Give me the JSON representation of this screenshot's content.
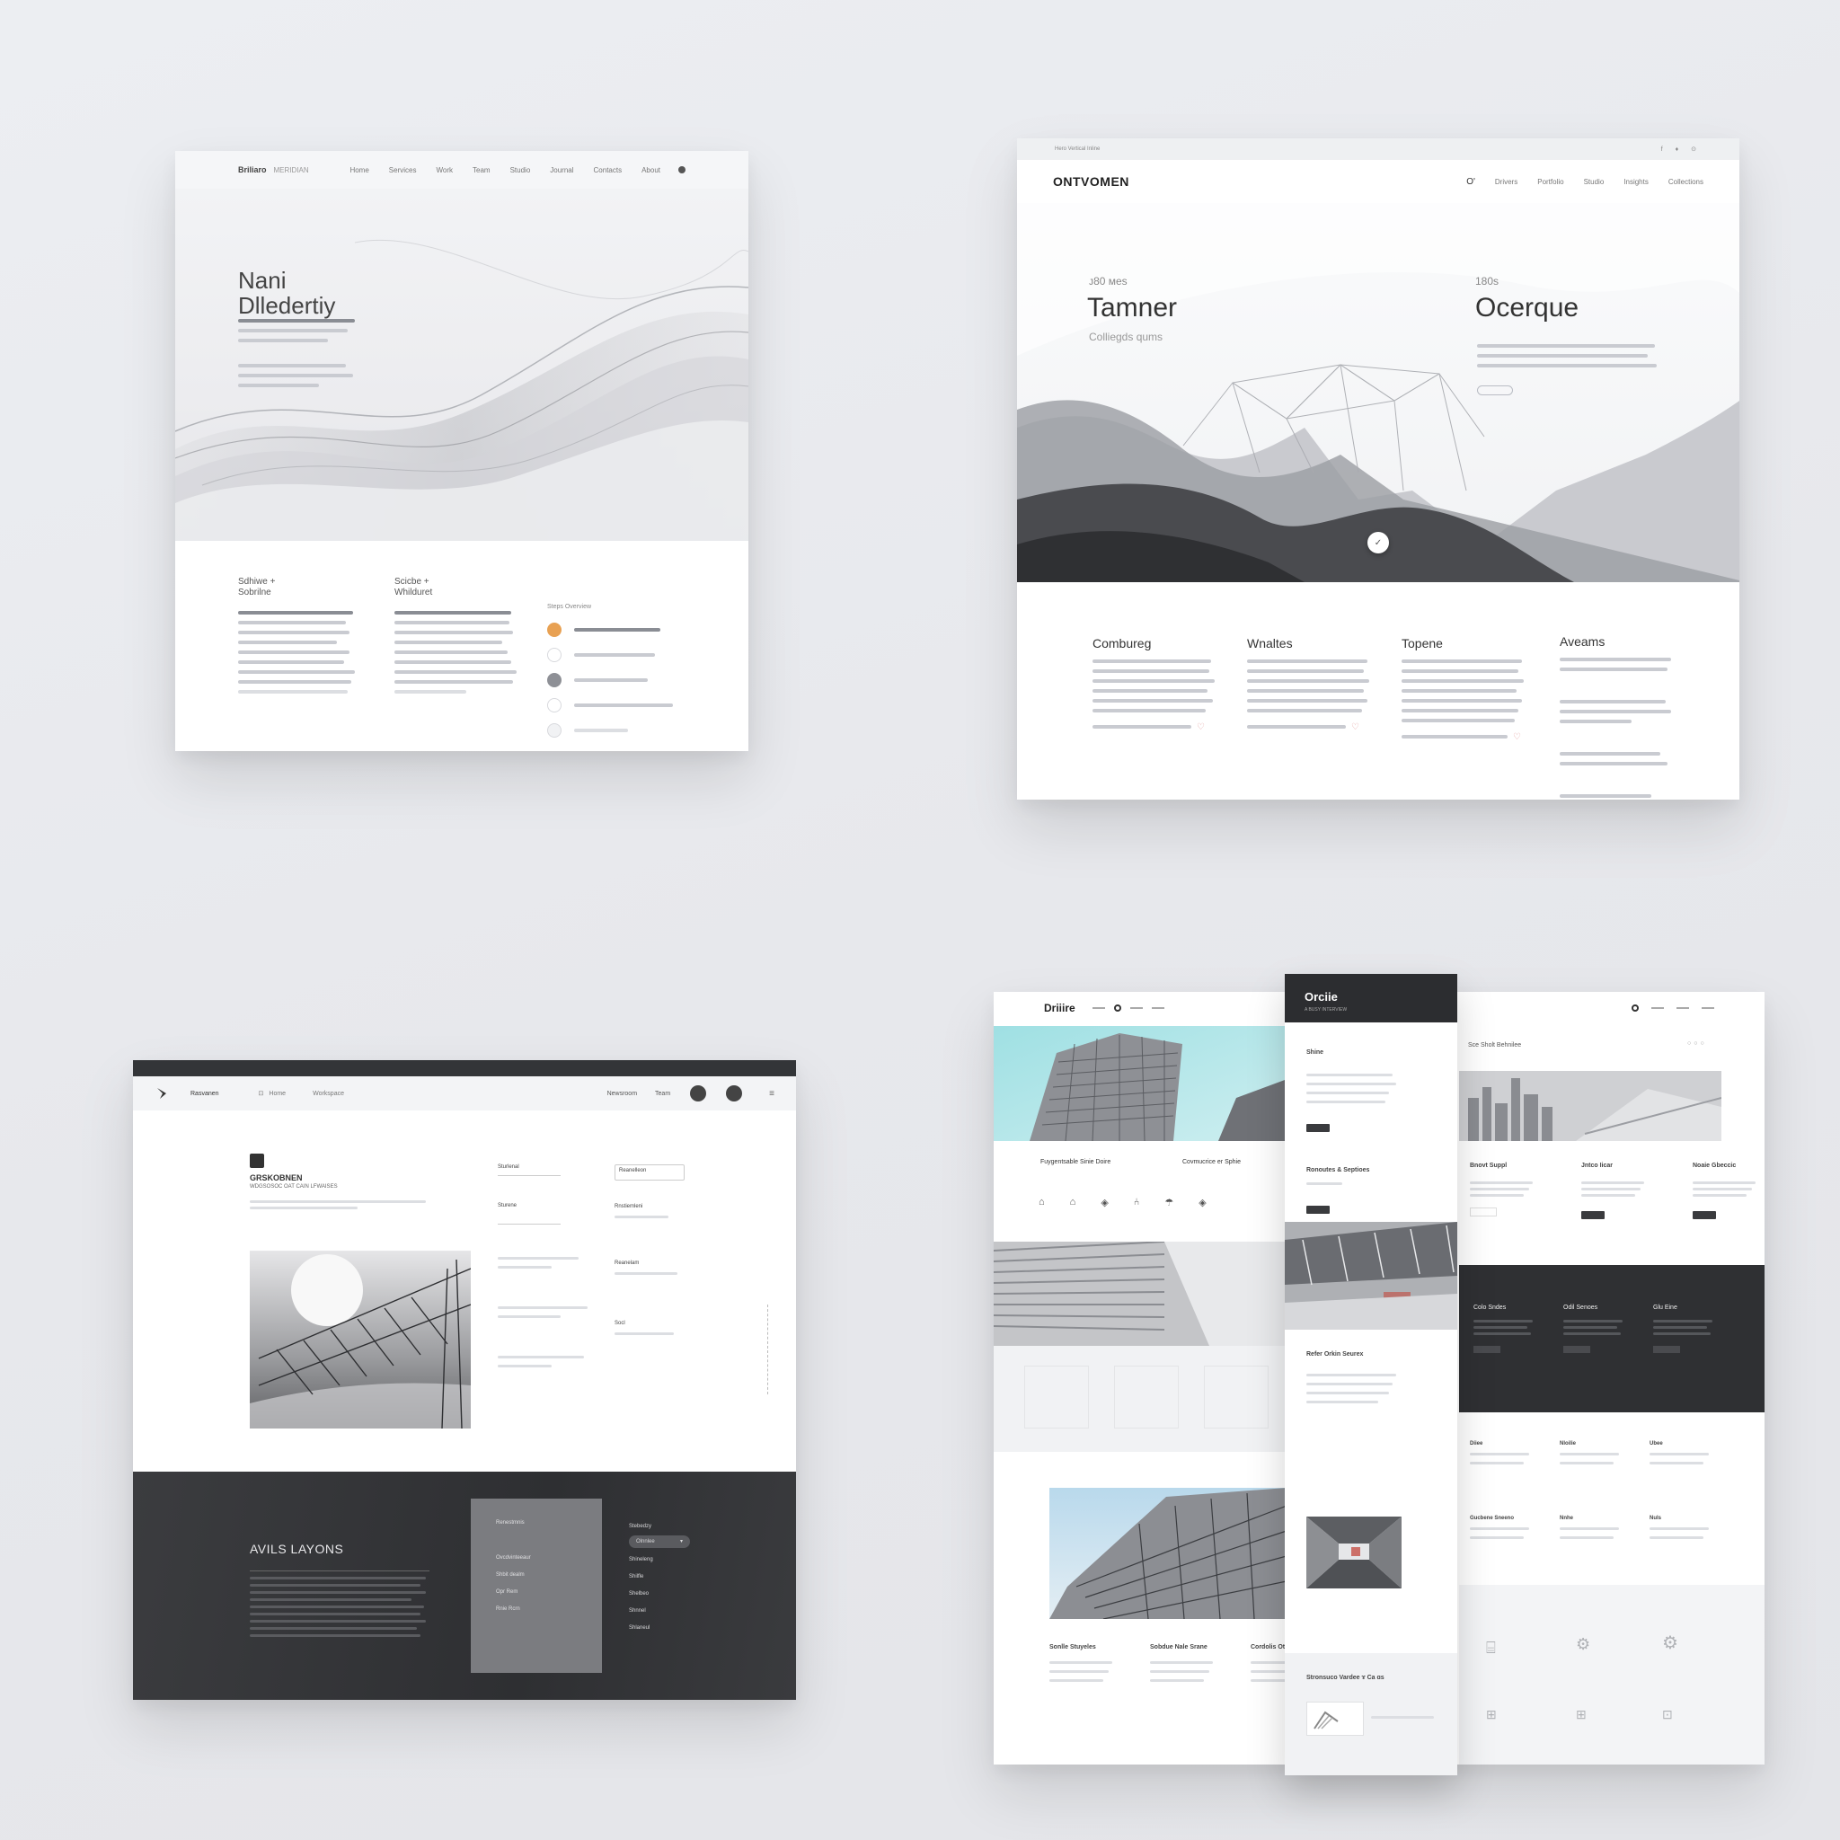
{
  "panel1": {
    "logo": "Briliaro",
    "logo_sub": "MERIDIAN",
    "nav": [
      "Home",
      "Services",
      "Work",
      "Team",
      "Studio",
      "Journal",
      "Contacts",
      "About"
    ],
    "hero_title_1": "Nani",
    "hero_title_2": "Dlledertiy",
    "col1_title_1": "Sdhiwe +",
    "col1_title_2": "Sobrilne",
    "col2_title_1": "Scicbe +",
    "col2_title_2": "Whilduret",
    "steps_title": "Steps Overview",
    "accent": "#e8a153"
  },
  "panel2": {
    "strip_text": "Hero Vertical Inline",
    "strip_icons": "f  ♦  ⊙",
    "logo": "ONTVOMEN",
    "nav": [
      "O'",
      "Drivers",
      "Portfolio",
      "Studio",
      "Insights",
      "Collections"
    ],
    "left_small": "ᴊ80 ᴍes",
    "left_big": "Tamner",
    "left_sub": "Colliegds qums",
    "right_small": "180s",
    "right_big": "Ocerque",
    "features": [
      "Combureg",
      "Wnaltes",
      "Topene",
      "Aveams"
    ]
  },
  "panel3": {
    "brand": "Rasvanen",
    "nav": [
      "Home",
      "Workspace"
    ],
    "right_links": [
      "Newsroom",
      "Team"
    ],
    "block_title": "GRSKOBNEN",
    "block_sub": "WDGSOSOC OAT CAIN LFWAISES",
    "right_col_titles": [
      "Sturlenal",
      "Sturene",
      "Reanelleon",
      "Rnstiemleni",
      "Reanelam",
      "Socl"
    ],
    "dark_title": "AVILS LAYONS",
    "dropdown_value": "Olnnlee",
    "dark_menu": [
      "Stebedzy",
      "Shineleng",
      "Shilfle",
      "Shelbeo",
      "Shnnel",
      "Shlaneul"
    ],
    "card_items": [
      "Renestmnis",
      "Ovcdvinteeaur",
      "Shbit dealm",
      "Opr Rem",
      "Rnie Rcrn"
    ]
  },
  "panel4": {
    "logo": "Driiire",
    "drawer_logo": "Orciie",
    "drawer_sub": "A BUSY INTERVIEW",
    "drawer_sections": [
      "Shine",
      "Ronoutes & Septioes",
      "Refer Orkin Seurex",
      "Stronsuco Vardee ɤ Ca ɑs"
    ],
    "section_titles": [
      "Fuygentsable Sinie Doire",
      "Covmucrice er Sphie"
    ],
    "right_title": "Sce Sholt Behnilee",
    "right_cols": [
      "Bnovt Suppl",
      "Jntco Iicar",
      "Noaie Gbeccic"
    ],
    "dark_cols": [
      "Colo Sndes",
      "Odil Senoes",
      "Glu Eine"
    ],
    "bottom_titles": [
      "Sonlle Stuyeles",
      "Sobdue Nale Srane",
      "Cordolis Otuilie"
    ],
    "right_lower": [
      "Diiee",
      "Nloilie",
      "Ubee",
      "Gucbene Sneeno",
      "Nnhe",
      "Nuls"
    ]
  }
}
